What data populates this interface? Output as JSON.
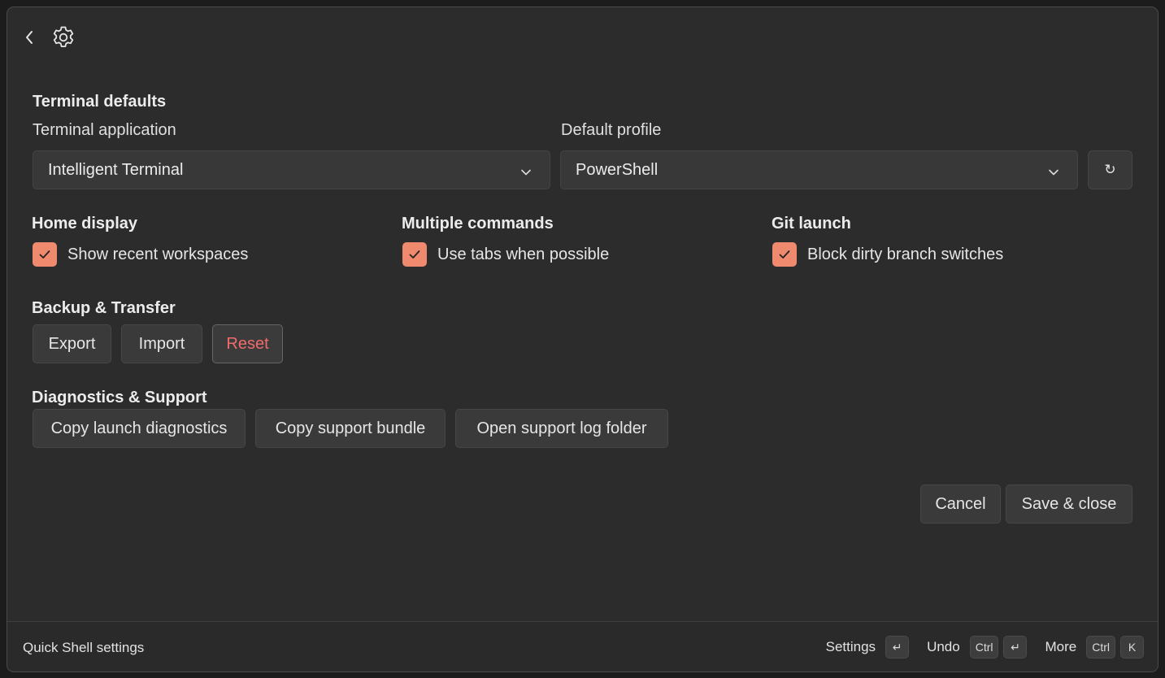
{
  "header": {
    "back_icon": "chevron-left-icon",
    "settings_icon": "gear-icon"
  },
  "terminal_defaults": {
    "title": "Terminal defaults",
    "terminal_application": {
      "label": "Terminal application",
      "value": "Intelligent Terminal"
    },
    "default_profile": {
      "label": "Default profile",
      "value": "PowerShell"
    },
    "refresh_icon": "refresh-icon",
    "refresh_glyph": "↻"
  },
  "home_display": {
    "title": "Home display",
    "checkbox_label": "Show recent workspaces",
    "checked": true
  },
  "multiple_commands": {
    "title": "Multiple commands",
    "checkbox_label": "Use tabs when possible",
    "checked": true
  },
  "git_launch": {
    "title": "Git launch",
    "checkbox_label": "Block dirty branch switches",
    "checked": true
  },
  "backup_transfer": {
    "title": "Backup & Transfer",
    "export_label": "Export",
    "import_label": "Import",
    "reset_label": "Reset"
  },
  "diagnostics": {
    "title": "Diagnostics & Support",
    "copy_launch_label": "Copy launch diagnostics",
    "copy_bundle_label": "Copy support bundle",
    "open_log_label": "Open support log folder"
  },
  "dialog_actions": {
    "cancel_label": "Cancel",
    "save_label": "Save & close"
  },
  "footer": {
    "title": "Quick Shell settings",
    "settings_label": "Settings",
    "undo_label": "Undo",
    "more_label": "More",
    "ctrl_key": "Ctrl",
    "k_key": "K",
    "enter_glyph": "↵"
  },
  "colors": {
    "accent": "#f08a6e",
    "danger": "#f06c6c",
    "background": "#2c2c2c"
  }
}
